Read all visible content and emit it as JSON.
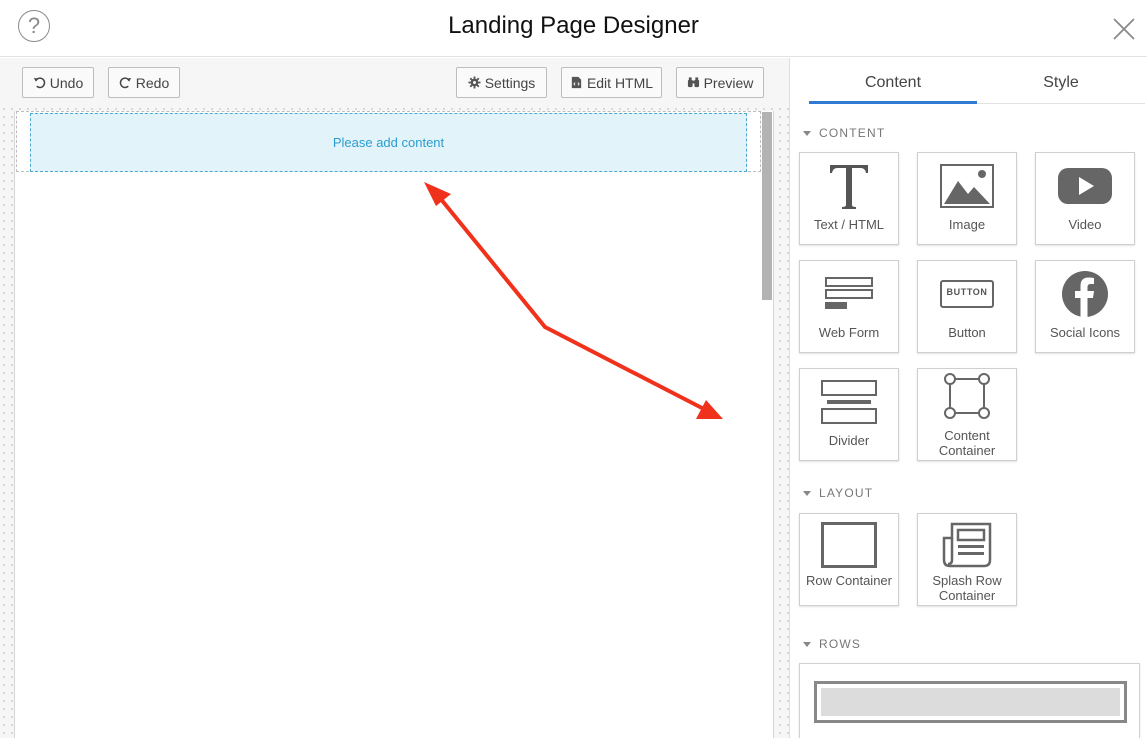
{
  "header": {
    "title": "Landing Page Designer",
    "help_icon": "help-circle-icon",
    "close_icon": "close-icon"
  },
  "toolbar": {
    "undo_label": "Undo",
    "redo_label": "Redo",
    "settings_label": "Settings",
    "edit_html_label": "Edit HTML",
    "preview_label": "Preview"
  },
  "canvas": {
    "placeholder": "Please add content"
  },
  "panel": {
    "tabs": [
      {
        "label": "Content",
        "active": true
      },
      {
        "label": "Style",
        "active": false
      }
    ],
    "sections": {
      "content": "CONTENT",
      "layout": "LAYOUT",
      "rows": "ROWS"
    },
    "content_items": [
      {
        "label": "Text / HTML",
        "icon": "text-icon"
      },
      {
        "label": "Image",
        "icon": "image-icon"
      },
      {
        "label": "Video",
        "icon": "video-icon"
      },
      {
        "label": "Web Form",
        "icon": "web-form-icon"
      },
      {
        "label": "Button",
        "icon": "button-icon"
      },
      {
        "label": "Social Icons",
        "icon": "facebook-icon"
      },
      {
        "label": "Divider",
        "icon": "divider-icon"
      },
      {
        "label": "Content Container",
        "icon": "container-icon"
      }
    ],
    "layout_items": [
      {
        "label": "Row Container",
        "icon": "row-container-icon"
      },
      {
        "label": "Splash Row Container",
        "icon": "splash-row-icon"
      }
    ],
    "button_icon_text": "BUTTON"
  },
  "colors": {
    "accent": "#2f7bd4",
    "dropzone_bg": "#e2f3fa",
    "dropzone_text": "#2b9ecf",
    "arrow": "#f0321d"
  }
}
